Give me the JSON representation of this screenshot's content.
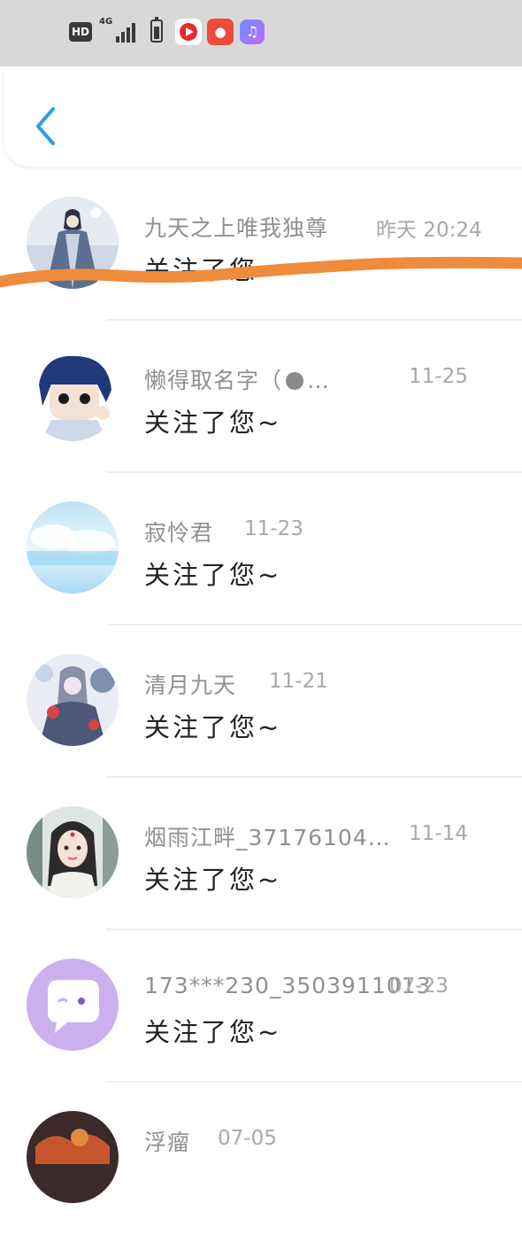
{
  "status_bar": {
    "hd": "HD",
    "network": "4G",
    "app_icons": [
      "video-app-icon",
      "kuaishou-icon",
      "music-app-icon"
    ]
  },
  "header": {
    "back_icon": "chevron-left-icon"
  },
  "colors": {
    "accent": "#2e9cf0",
    "scribble": "#ef8b3c",
    "name": "#909090",
    "message": "#222222"
  },
  "notifications": [
    {
      "name": "九天之上唯我独尊",
      "time": "昨天 20:24",
      "message": "关注了您~"
    },
    {
      "name": "懒得取名字（",
      "name_suffix": "…",
      "time": "11-25",
      "message": "关注了您~"
    },
    {
      "name": "寂怜君",
      "time": "11-23",
      "message": "关注了您~"
    },
    {
      "name": "清月九天",
      "time": "11-21",
      "message": "关注了您~"
    },
    {
      "name": "烟雨江畔_37176104…",
      "time": "11-14",
      "message": "关注了您~"
    },
    {
      "name": "173***230_3503911013",
      "time": "07-23",
      "message": "关注了您~"
    },
    {
      "name": "浮瘤",
      "time": "07-05",
      "message": ""
    }
  ]
}
